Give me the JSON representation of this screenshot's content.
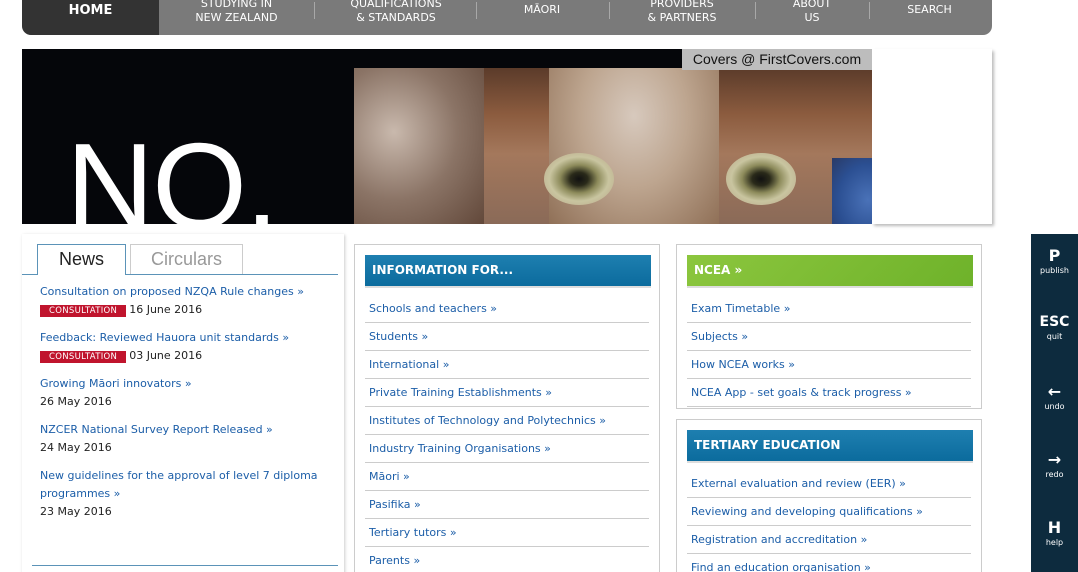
{
  "nav": {
    "home": "HOME",
    "items": [
      {
        "line1": "STUDYING IN",
        "line2": "NEW ZEALAND"
      },
      {
        "line1": "QUALIFICATIONS",
        "line2": "& STANDARDS"
      },
      {
        "line1": "MĀORI",
        "line2": ""
      },
      {
        "line1": "PROVIDERS",
        "line2": "& PARTNERS"
      },
      {
        "line1": "ABOUT",
        "line2": "US"
      },
      {
        "line1": "SEARCH",
        "line2": ""
      }
    ]
  },
  "banner": {
    "text": "NO.",
    "credit": "Covers @ FirstCovers.com"
  },
  "news": {
    "tabs": [
      "News",
      "Circulars"
    ],
    "items": [
      {
        "title": "Consultation on proposed NZQA Rule changes »",
        "badge": "CONSULTATION",
        "date": "16 June 2016"
      },
      {
        "title": "Feedback: Reviewed Hauora unit standards »",
        "badge": "CONSULTATION",
        "date": "03 June 2016"
      },
      {
        "title": "Growing Māori innovators »",
        "badge": "",
        "date": "26 May 2016"
      },
      {
        "title": "NZCER National Survey Report Released »",
        "badge": "",
        "date": "24 May 2016"
      },
      {
        "title": "New guidelines for the approval of level 7 diploma programmes »",
        "badge": "",
        "date": "23 May 2016"
      }
    ]
  },
  "info": {
    "heading": "INFORMATION FOR...",
    "links": [
      "Schools and teachers »",
      "Students »",
      "International »",
      "Private Training Establishments »",
      "Institutes of Technology and Polytechnics »",
      "Industry Training Organisations »",
      "Māori »",
      "Pasifika »",
      "Tertiary tutors »",
      "Parents »"
    ]
  },
  "ncea": {
    "heading": "NCEA »",
    "links": [
      "Exam Timetable »",
      "Subjects »",
      "How NCEA works »",
      "NCEA App - set goals & track progress »"
    ]
  },
  "tertiary": {
    "heading": "TERTIARY EDUCATION",
    "links": [
      "External evaluation and review (EER) »",
      "Reviewing and developing qualifications »",
      "Registration and accreditation »",
      "Find an education organisation »"
    ]
  },
  "toolbar": [
    {
      "key": "P",
      "label": "publish"
    },
    {
      "key": "ESC",
      "label": "quit"
    },
    {
      "key": "←",
      "label": "undo"
    },
    {
      "key": "→",
      "label": "redo"
    },
    {
      "key": "H",
      "label": "help"
    }
  ],
  "colors": {
    "nav_bg": "#7a7a7a",
    "nav_home_bg": "#333333",
    "link": "#1c5ea8",
    "badge": "#c0142d",
    "head_blue": "#0a6a9c",
    "head_green": "#7dbb33",
    "toolbar_bg": "#0d2b3e"
  }
}
